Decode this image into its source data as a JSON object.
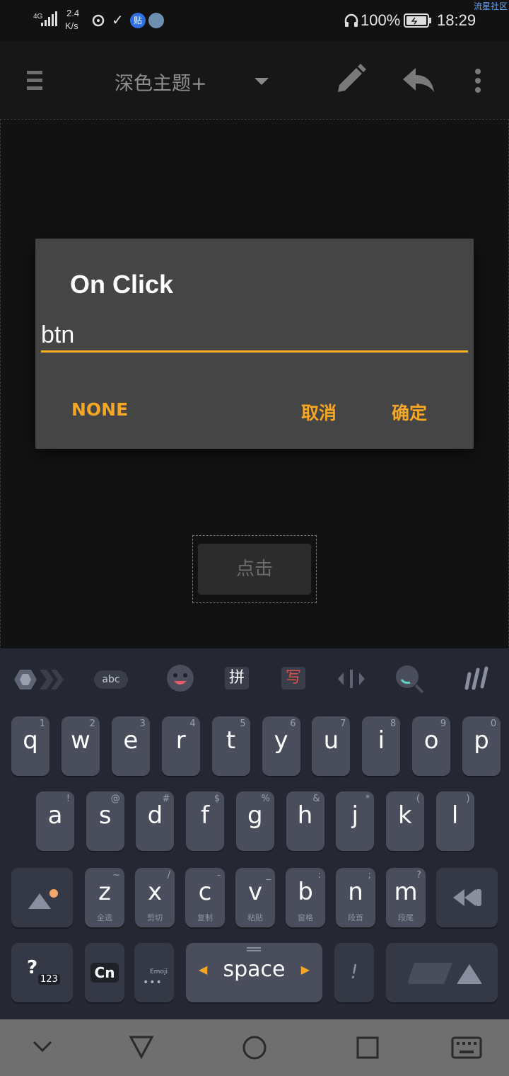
{
  "status_bar": {
    "network": "4G",
    "speed_value": "2.4",
    "speed_unit": "K/s",
    "battery": "100%",
    "time": "18:29",
    "watermark": "流星社区"
  },
  "toolbar": {
    "title": "深色主题+"
  },
  "dialog": {
    "title": "On Click",
    "input_value": "btn",
    "none_label": "NONE",
    "cancel_label": "取消",
    "ok_label": "确定"
  },
  "canvas": {
    "button_label": "点击"
  },
  "keyboard": {
    "toolbar": {
      "abc_label": "abc",
      "pinyin_label": "拼",
      "write_label": "写"
    },
    "row1": [
      {
        "ch": "q",
        "sup": "1"
      },
      {
        "ch": "w",
        "sup": "2"
      },
      {
        "ch": "e",
        "sup": "3"
      },
      {
        "ch": "r",
        "sup": "4"
      },
      {
        "ch": "t",
        "sup": "5"
      },
      {
        "ch": "y",
        "sup": "6"
      },
      {
        "ch": "u",
        "sup": "7"
      },
      {
        "ch": "i",
        "sup": "8"
      },
      {
        "ch": "o",
        "sup": "9"
      },
      {
        "ch": "p",
        "sup": "0"
      }
    ],
    "row2": [
      {
        "ch": "a",
        "sup": "!"
      },
      {
        "ch": "s",
        "sup": "@"
      },
      {
        "ch": "d",
        "sup": "#"
      },
      {
        "ch": "f",
        "sup": "$"
      },
      {
        "ch": "g",
        "sup": "%"
      },
      {
        "ch": "h",
        "sup": "&"
      },
      {
        "ch": "j",
        "sup": "*"
      },
      {
        "ch": "k",
        "sup": "("
      },
      {
        "ch": "l",
        "sup": ")"
      }
    ],
    "row3": [
      {
        "ch": "z",
        "sup": "~",
        "sub": "全选"
      },
      {
        "ch": "x",
        "sup": "/",
        "sub": "剪切"
      },
      {
        "ch": "c",
        "sup": "-",
        "sub": "复制"
      },
      {
        "ch": "v",
        "sup": "_",
        "sub": "粘贴"
      },
      {
        "ch": "b",
        "sup": ":",
        "sub": "窗格"
      },
      {
        "ch": "n",
        "sup": ";",
        "sub": "段首"
      },
      {
        "ch": "m",
        "sup": "?",
        "sub": "段尾"
      }
    ],
    "row4": {
      "num_label": "?",
      "num_sub": "123",
      "cn_label": "Cn",
      "emoji_label": "Emoji",
      "space_label": "space",
      "punct_label": "!"
    }
  },
  "colors": {
    "accent": "#f5a623",
    "dialog_bg": "#454545",
    "keyboard_bg": "#252833",
    "key_bg": "#4a4e5c"
  }
}
